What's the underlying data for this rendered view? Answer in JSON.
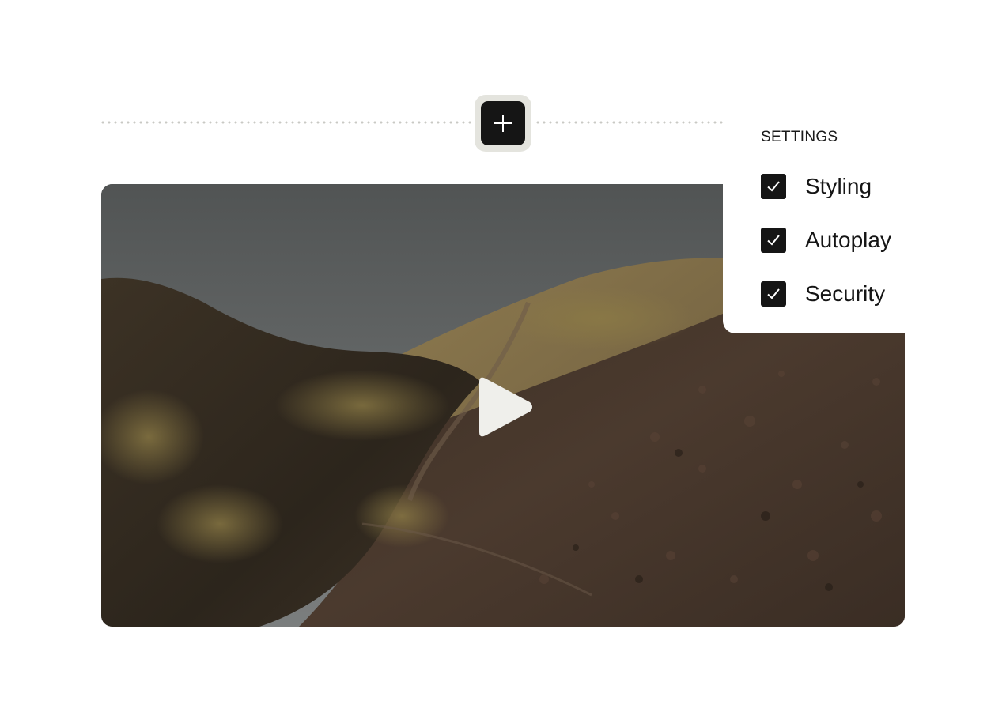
{
  "toolbar": {
    "add_icon": "plus-icon"
  },
  "video": {
    "play_icon": "play-icon",
    "scene": "volcanic hillside under overcast sky"
  },
  "settings": {
    "title": "SETTINGS",
    "options": [
      {
        "label": "Styling",
        "checked": true
      },
      {
        "label": "Autoplay",
        "checked": true
      },
      {
        "label": "Security",
        "checked": true
      }
    ],
    "check_icon": "checkmark-icon"
  },
  "colors": {
    "dark": "#151515",
    "button_ring": "#e4e4de",
    "play": "#efefeb"
  }
}
